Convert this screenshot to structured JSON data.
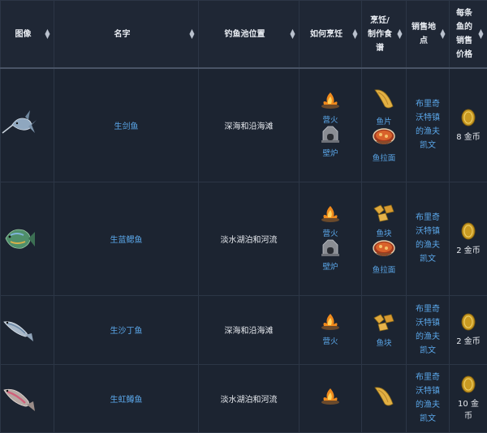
{
  "headers": [
    "图像",
    "名字",
    "钓鱼池位置",
    "如何烹饪",
    "烹饪/制作食谱",
    "销售地点",
    "每条鱼的销售价格"
  ],
  "headers_lines": [
    [
      "图像"
    ],
    [
      "名字"
    ],
    [
      "钓鱼池位置"
    ],
    [
      "如何烹饪"
    ],
    [
      "烹饪/",
      "制作食",
      "谱"
    ],
    [
      "销售地",
      "点"
    ],
    [
      "每条",
      "鱼的",
      "销售",
      "价格"
    ]
  ],
  "sort_icon": "sort-arrows-icon",
  "rows": [
    {
      "name": "生剑鱼",
      "pool": "深海和沿海滩",
      "cook": [
        {
          "icon": "campfire-icon",
          "label": "营火"
        },
        {
          "icon": "stove-icon",
          "label": "壁炉"
        }
      ],
      "recipe": [
        {
          "icon": "fish-fillet-icon",
          "label": "鱼片"
        },
        {
          "icon": "fish-bowl-icon",
          "label": "鱼拉面"
        }
      ],
      "place_lines": [
        "布里奇",
        "沃特镇",
        "的渔夫",
        "凯文"
      ],
      "price_lines": [
        "8 金币"
      ]
    },
    {
      "name": "生蓝鳃鱼",
      "pool": "淡水湖泊和河流",
      "cook": [
        {
          "icon": "campfire-icon",
          "label": "营火"
        },
        {
          "icon": "stove-icon",
          "label": "壁炉"
        }
      ],
      "recipe": [
        {
          "icon": "fish-nuggets-icon",
          "label": "鱼块"
        },
        {
          "icon": "fish-bowl-icon",
          "label": "鱼拉面"
        }
      ],
      "place_lines": [
        "布里奇",
        "沃特镇",
        "的渔夫",
        "凯文"
      ],
      "price_lines": [
        "2 金币"
      ]
    },
    {
      "name": "生沙丁鱼",
      "pool": "深海和沿海滩",
      "cook": [
        {
          "icon": "campfire-icon",
          "label": "营火"
        }
      ],
      "recipe": [
        {
          "icon": "fish-nuggets-icon",
          "label": "鱼块"
        }
      ],
      "place_lines": [
        "布里奇",
        "沃特镇",
        "的渔夫",
        "凯文"
      ],
      "price_lines": [
        "2 金币"
      ]
    },
    {
      "name": "生虹鳟鱼",
      "pool": "淡水湖泊和河流",
      "cook": [
        {
          "icon": "campfire-icon",
          "label": ""
        }
      ],
      "recipe": [
        {
          "icon": "fish-fillet-icon",
          "label": ""
        }
      ],
      "place_lines": [
        "布里奇",
        "沃特镇",
        "的渔夫",
        "凯文"
      ],
      "price_lines": [
        "10 金",
        "币"
      ]
    }
  ]
}
